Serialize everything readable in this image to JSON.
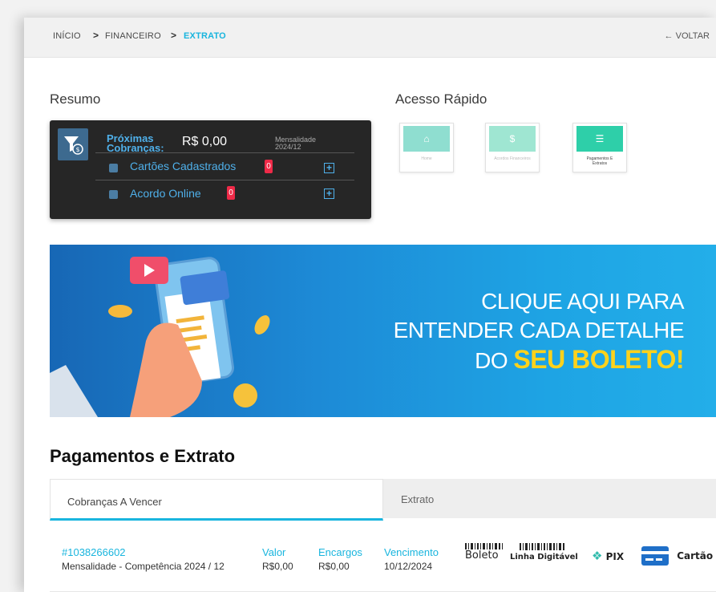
{
  "breadcrumb": {
    "items": [
      "INÍCIO",
      "FINANCEIRO",
      "EXTRATO"
    ],
    "separator": ">",
    "back": "VOLTAR"
  },
  "resumo": {
    "title": "Resumo",
    "next_label": "Próximas Cobranças:",
    "next_value": "R$ 0,00",
    "next_tag": "Mensalidade",
    "next_month": "2024/12",
    "cards_label": "Cartões Cadastrados",
    "cards_count": "0",
    "acordo_label": "Acordo Online",
    "acordo_count": "0",
    "plus": "+"
  },
  "acesso": {
    "title": "Acesso Rápido",
    "items": [
      {
        "label": "Home",
        "color": "#8fded0"
      },
      {
        "label": "Acordos Financeiros",
        "color": "#9fe6d2"
      },
      {
        "label": "Pagamentos E Extratos",
        "color": "#2ecfa9"
      }
    ]
  },
  "banner": {
    "line1": "CLIQUE AQUI PARA",
    "line2": "ENTENDER CADA DETALHE",
    "line3_prefix": "DO",
    "line3_highlight": "SEU BOLETO!"
  },
  "pagamentos": {
    "title": "Pagamentos e Extrato",
    "tabs": [
      "Cobranças A Vencer",
      "Extrato"
    ],
    "invoice": {
      "id": "#1038266602",
      "desc": "Mensalidade - Competência 2024 / 12",
      "valor_label": "Valor",
      "valor": "R$0,00",
      "encargos_label": "Encargos",
      "encargos": "R$0,00",
      "venc_label": "Vencimento",
      "venc": "10/12/2024",
      "pay": [
        "Boleto",
        "Linha Digitável",
        "PIX",
        "Cartão"
      ]
    }
  },
  "colors": {
    "accent": "#19b5de",
    "card_bg": "#262626",
    "badge": "#ef2a48",
    "highlight": "#ffd21b"
  }
}
